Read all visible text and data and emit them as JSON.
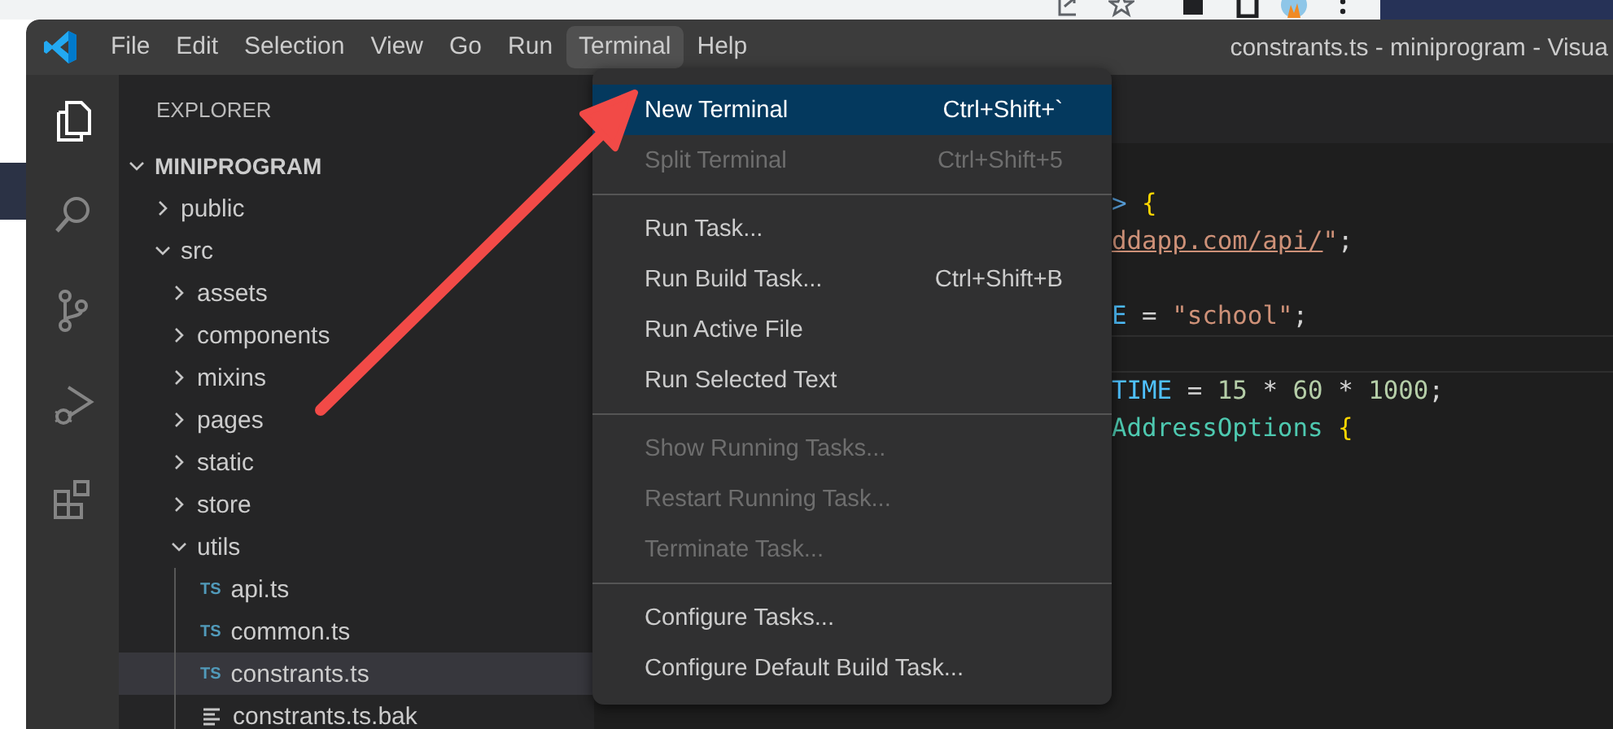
{
  "window": {
    "title": "constrants.ts - miniprogram - Visua",
    "menu_bar": [
      {
        "label": "File",
        "selected": false
      },
      {
        "label": "Edit",
        "selected": false
      },
      {
        "label": "Selection",
        "selected": false
      },
      {
        "label": "View",
        "selected": false
      },
      {
        "label": "Go",
        "selected": false
      },
      {
        "label": "Run",
        "selected": false
      },
      {
        "label": "Terminal",
        "selected": true
      },
      {
        "label": "Help",
        "selected": false
      }
    ]
  },
  "activity_bar": [
    {
      "kind": "explorer",
      "selected": true
    },
    {
      "kind": "search",
      "selected": false
    },
    {
      "kind": "source-control",
      "selected": false
    },
    {
      "kind": "run-debug",
      "selected": false
    },
    {
      "kind": "extensions",
      "selected": false
    }
  ],
  "explorer": {
    "title": "EXPLORER",
    "folder": {
      "name": "MINIPROGRAM",
      "expanded": true,
      "children": [
        {
          "name": "public",
          "kind": "folder",
          "expanded": false,
          "selected": false
        },
        {
          "name": "src",
          "kind": "folder",
          "expanded": true,
          "selected": false,
          "children": [
            {
              "name": "assets",
              "kind": "folder",
              "expanded": false,
              "selected": false
            },
            {
              "name": "components",
              "kind": "folder",
              "expanded": false,
              "selected": false
            },
            {
              "name": "mixins",
              "kind": "folder",
              "expanded": false,
              "selected": false
            },
            {
              "name": "pages",
              "kind": "folder",
              "expanded": false,
              "selected": false
            },
            {
              "name": "static",
              "kind": "folder",
              "expanded": false,
              "selected": false
            },
            {
              "name": "store",
              "kind": "folder",
              "expanded": false,
              "selected": false
            },
            {
              "name": "utils",
              "kind": "folder",
              "expanded": true,
              "selected": false,
              "children": [
                {
                  "name": "api.ts",
                  "kind": "file",
                  "badge": "TS",
                  "selected": false
                },
                {
                  "name": "common.ts",
                  "kind": "file",
                  "badge": "TS",
                  "selected": false
                },
                {
                  "name": "constrants.ts",
                  "kind": "file",
                  "badge": "TS",
                  "selected": true
                },
                {
                  "name": "constrants.ts.bak",
                  "kind": "text-file",
                  "selected": false
                }
              ]
            }
          ]
        }
      ]
    }
  },
  "editor": {
    "lines": [
      {
        "current": false,
        "tokens": [
          {
            "text": ">",
            "color": "#569cd6"
          },
          {
            "text": " {",
            "color": "#ffd700"
          }
        ]
      },
      {
        "current": false,
        "tokens": [
          {
            "text": "ddapp.com/api/",
            "color": "#ce9178",
            "underline": true
          },
          {
            "text": "\"",
            "color": "#ce9178"
          },
          {
            "text": ";",
            "color": "#d4d4d4"
          }
        ]
      },
      {
        "current": false
      },
      {
        "current": false,
        "tokens": [
          {
            "text": "E",
            "color": "#4fc1ff"
          },
          {
            "text": " = ",
            "color": "#d4d4d4"
          },
          {
            "text": "\"school\"",
            "color": "#ce9178"
          },
          {
            "text": ";",
            "color": "#d4d4d4"
          }
        ]
      },
      {
        "current": true
      },
      {
        "current": false,
        "tokens": [
          {
            "text": "TIME",
            "color": "#4fc1ff"
          },
          {
            "text": " = ",
            "color": "#d4d4d4"
          },
          {
            "text": "15",
            "color": "#b5cea8"
          },
          {
            "text": " * ",
            "color": "#d4d4d4"
          },
          {
            "text": "60",
            "color": "#b5cea8"
          },
          {
            "text": " * ",
            "color": "#d4d4d4"
          },
          {
            "text": "1000",
            "color": "#b5cea8"
          },
          {
            "text": ";",
            "color": "#d4d4d4"
          }
        ]
      },
      {
        "current": false,
        "tokens": [
          {
            "text": "AddressOptions",
            "color": "#4ec9b0"
          },
          {
            "text": " {",
            "color": "#ffd700"
          }
        ]
      }
    ]
  },
  "terminal_menu": {
    "groups": [
      [
        {
          "label": "New Terminal",
          "shortcut": "Ctrl+Shift+`",
          "disabled": false,
          "selected": true
        },
        {
          "label": "Split Terminal",
          "shortcut": "Ctrl+Shift+5",
          "disabled": true,
          "selected": false
        }
      ],
      [
        {
          "label": "Run Task...",
          "disabled": false,
          "selected": false
        },
        {
          "label": "Run Build Task...",
          "shortcut": "Ctrl+Shift+B",
          "disabled": false,
          "selected": false
        },
        {
          "label": "Run Active File",
          "disabled": false,
          "selected": false
        },
        {
          "label": "Run Selected Text",
          "disabled": false,
          "selected": false
        }
      ],
      [
        {
          "label": "Show Running Tasks...",
          "disabled": true,
          "selected": false
        },
        {
          "label": "Restart Running Task...",
          "disabled": true,
          "selected": false
        },
        {
          "label": "Terminate Task...",
          "disabled": true,
          "selected": false
        }
      ],
      [
        {
          "label": "Configure Tasks...",
          "disabled": false,
          "selected": false
        },
        {
          "label": "Configure Default Build Task...",
          "disabled": false,
          "selected": false
        }
      ]
    ]
  }
}
